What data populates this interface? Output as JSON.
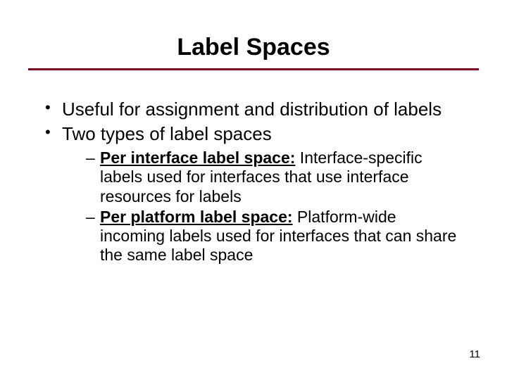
{
  "title": "Label Spaces",
  "bullets": {
    "b0": "Useful for assignment and distribution of labels",
    "b1": "Two types of label spaces"
  },
  "sub": {
    "s0_lead": "Per interface label space:",
    "s0_rest": " Interface-specific labels used for interfaces that use interface resources for labels",
    "s1_lead": "Per platform label space:",
    "s1_rest": " Platform-wide incoming labels used for interfaces that can share the same label space"
  },
  "page_number": "11"
}
